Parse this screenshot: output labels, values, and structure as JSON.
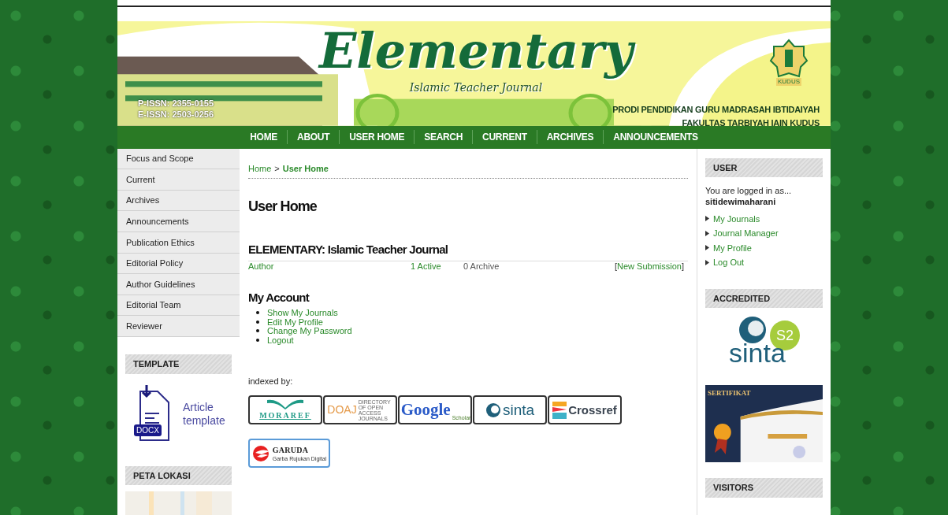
{
  "banner": {
    "title": "Elementary",
    "subtitle": "Islamic Teacher Journal",
    "issn": [
      "P-ISSN: 2355-0155",
      "E-ISSN: 2503-0256"
    ],
    "logo_caption": "KUDUS",
    "institution": [
      "PRODI PENDIDIKAN GURU MADRASAH IBTIDAIYAH",
      "FAKULTAS TARBIYAH IAIN KUDUS"
    ]
  },
  "nav": [
    "HOME",
    "ABOUT",
    "USER HOME",
    "SEARCH",
    "CURRENT",
    "ARCHIVES",
    "ANNOUNCEMENTS"
  ],
  "sidebar": {
    "items": [
      "Focus and Scope",
      "Current",
      "Archives",
      "Announcements",
      "Publication Ethics",
      "Editorial Policy",
      "Author Guidelines",
      "Editorial Team",
      "Reviewer"
    ],
    "template": {
      "heading": "TEMPLATE",
      "badge": "DOCX",
      "label": "Article template"
    },
    "map": {
      "heading": "PETA LOKASI"
    }
  },
  "breadcrumb": {
    "home": "Home",
    "separator": ">",
    "current": "User Home"
  },
  "page_title": "User Home",
  "journal": {
    "title": "ELEMENTARY: Islamic Teacher Journal",
    "role": "Author",
    "active": "1 Active",
    "archive": "0 Archive",
    "open": "[",
    "new_submission": "New Submission",
    "close": "]"
  },
  "account": {
    "heading": "My Account",
    "links": [
      "Show My Journals",
      "Edit My Profile",
      "Change My Password",
      "Logout"
    ]
  },
  "indexed": {
    "label": "indexed by:",
    "logos": [
      {
        "kind": "moraref",
        "name": "MORAREF"
      },
      {
        "kind": "doaj",
        "name": "DOAJ",
        "sub": "DIRECTORY OF OPEN ACCESS JOURNALS"
      },
      {
        "kind": "google",
        "name": "Google",
        "sub": "Scholar"
      },
      {
        "kind": "sinta",
        "name": "sinta"
      },
      {
        "kind": "crossref",
        "name": "Crossref"
      },
      {
        "kind": "garuda",
        "name": "GARUDA",
        "sub": "Garba Rujukan Digital"
      }
    ]
  },
  "right": {
    "user": {
      "heading": "USER",
      "logged_in": "You are logged in as...",
      "username": "sitidewimaharani",
      "links": [
        "My Journals",
        "Journal Manager",
        "My Profile",
        "Log Out"
      ]
    },
    "accredited": {
      "heading": "ACCREDITED",
      "sinta": "sinta",
      "grade": "S2",
      "certificate": "SERTIFIKAT"
    },
    "visitors": {
      "heading": "VISITORS"
    }
  }
}
